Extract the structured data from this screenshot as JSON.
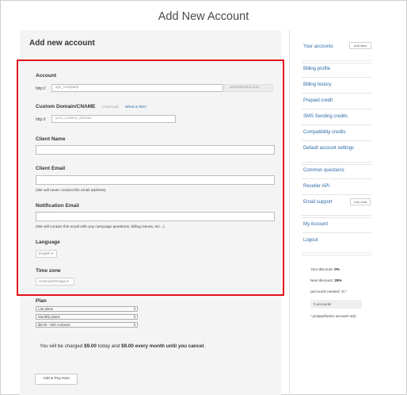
{
  "page_title": "Add New Account",
  "section_title": "Add new account",
  "account": {
    "label": "Account",
    "prefix": "http://",
    "value": "xyz_company",
    "suffix": ".activehosted.com"
  },
  "custom_domain": {
    "label": "Custom Domain/CNAME",
    "optional": "(Optional)",
    "help_link": "What is this?",
    "prefix": "http://",
    "placeholder": "your_custom_domain"
  },
  "client_name": {
    "label": "Client Name"
  },
  "client_email": {
    "label": "Client Email",
    "hint": "(We will never contact this email address)"
  },
  "notification_email": {
    "label": "Notification Email",
    "hint": "(We will contact this email with any campaign questions, billing issues, etc...)"
  },
  "language": {
    "label": "Language",
    "selected": "English"
  },
  "timezone": {
    "label": "Time zone",
    "selected": "America/Chicago"
  },
  "plan": {
    "label": "Plan",
    "selects": [
      "Lite plans",
      "Monthly plans",
      "$9.00 - 500 contacts"
    ]
  },
  "charge": {
    "prefix": "You will be charged ",
    "today_amount": "$9.00",
    "middle": " today and ",
    "recurring": "$9.00 every month until you cancel",
    "end": "."
  },
  "submit_label": "Add & Pay Now",
  "sidebar": {
    "your_accounts": "Your accounts",
    "add_new": "Add New",
    "links": [
      "Billing profile",
      "Billing history",
      "Prepaid credit",
      "SMS Sending credits",
      "Compatibility credits",
      "Default account settings"
    ],
    "help_links": [
      "Common questions",
      "Reseller API"
    ],
    "email_support": "Email support",
    "live_chat": "Live chat",
    "my_account": "My Account",
    "logout": "Logout",
    "discount_label": "Your discount: ",
    "discount_value": "0%",
    "next_discount_label": "Next discount: ",
    "next_discount_value": "25%",
    "accounts_needed": "(accounts needed: 2) *",
    "accounts_count": "0 accounts",
    "footnote": "* postpaid/active accounts only"
  },
  "colors": {
    "highlight": "#e1111a",
    "link": "#2b6aa8"
  }
}
